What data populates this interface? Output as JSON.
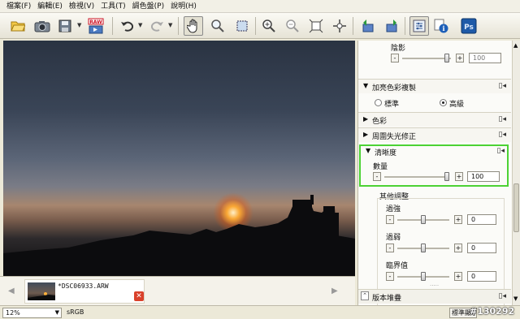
{
  "menubar": {
    "items": [
      "檔案(F)",
      "編輯(E)",
      "檢視(V)",
      "工具(T)",
      "調色盤(P)",
      "說明(H)"
    ]
  },
  "toolbar": {
    "buttons": [
      "folder-open-icon",
      "camera-icon",
      "save-icon",
      "raw-convert-icon",
      "undo-icon",
      "redo-icon",
      "hand-tool-icon",
      "zoom-tool-icon",
      "select-tool-icon",
      "zoom-in-icon",
      "zoom-out-icon",
      "fit-window-icon",
      "move-icon",
      "rotate-left-icon",
      "rotate-right-icon",
      "adjust-icon",
      "info-icon",
      "photoshop-icon"
    ],
    "raw_label": "RAW",
    "ps_label": "Ps"
  },
  "filmstrip": {
    "filename": "*DSC06933.ARW"
  },
  "panel": {
    "shadow_label": "陰影",
    "shadow_value": "100",
    "color_reproduction_title": "加亮色彩複製",
    "radio_standard": "標準",
    "radio_advanced": "高級",
    "radio_selected": "advanced",
    "color_title": "色彩",
    "vignetting_title": "周圍失光修正",
    "sharpness_title": "清晰度",
    "amount_label": "數量",
    "amount_value": "100",
    "other_adjust_label": "其他調整",
    "overshoot_label": "過強",
    "overshoot_value": "0",
    "undershoot_label": "過弱",
    "undershoot_value": "0",
    "threshold_label": "臨界值",
    "threshold_value": "0",
    "version_stack_label": "版本堆疊"
  },
  "statusbar": {
    "zoom": "12%",
    "colorspace": "sRGB",
    "mode": "標準顯示",
    "post_id": "#130292"
  },
  "colors": {
    "highlight": "#4cd234",
    "ps_blue": "#1e5aa8"
  }
}
